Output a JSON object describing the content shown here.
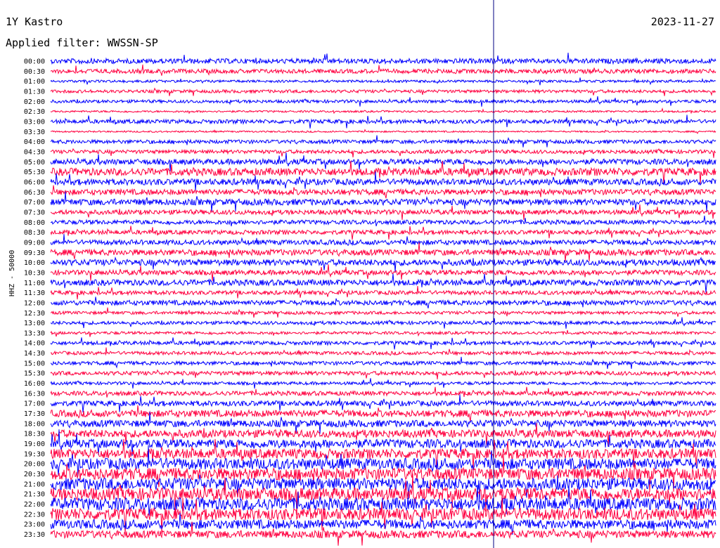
{
  "header": {
    "station": "1Y Kastro",
    "date": "2023-11-27",
    "filter_text": "Applied filter: WWSSN-SP"
  },
  "chart_data": {
    "type": "line",
    "title": "1Y Kastro",
    "ylabel": "HHZ - 50000",
    "row_labels": [
      "00:00",
      "00:30",
      "01:00",
      "01:30",
      "02:00",
      "02:30",
      "03:00",
      "03:30",
      "04:00",
      "04:30",
      "05:00",
      "05:30",
      "06:00",
      "06:30",
      "07:00",
      "07:30",
      "08:00",
      "08:30",
      "09:00",
      "09:30",
      "10:00",
      "10:30",
      "11:00",
      "11:30",
      "12:00",
      "12:30",
      "13:00",
      "13:30",
      "14:00",
      "14:30",
      "15:00",
      "15:30",
      "16:00",
      "16:30",
      "17:00",
      "17:30",
      "18:00",
      "18:30",
      "19:00",
      "19:30",
      "20:00",
      "20:30",
      "21:00",
      "21:30",
      "22:00",
      "22:30",
      "23:00",
      "23:30"
    ],
    "series_colors": [
      "#0000ff",
      "#ff0040"
    ],
    "marker_color": "#000080",
    "relative_amplitude": [
      1.6,
      1.4,
      0.8,
      1.0,
      1.0,
      0.6,
      1.3,
      0.5,
      1.2,
      1.2,
      1.8,
      2.4,
      2.0,
      1.8,
      2.0,
      1.5,
      1.4,
      1.4,
      1.6,
      1.9,
      2.0,
      1.6,
      1.9,
      1.3,
      1.6,
      1.0,
      1.1,
      0.9,
      1.2,
      1.1,
      1.2,
      1.3,
      1.0,
      1.4,
      1.7,
      2.2,
      2.2,
      2.5,
      2.8,
      3.2,
      3.6,
      3.8,
      3.9,
      4.0,
      4.0,
      3.8,
      3.0,
      2.4
    ]
  }
}
